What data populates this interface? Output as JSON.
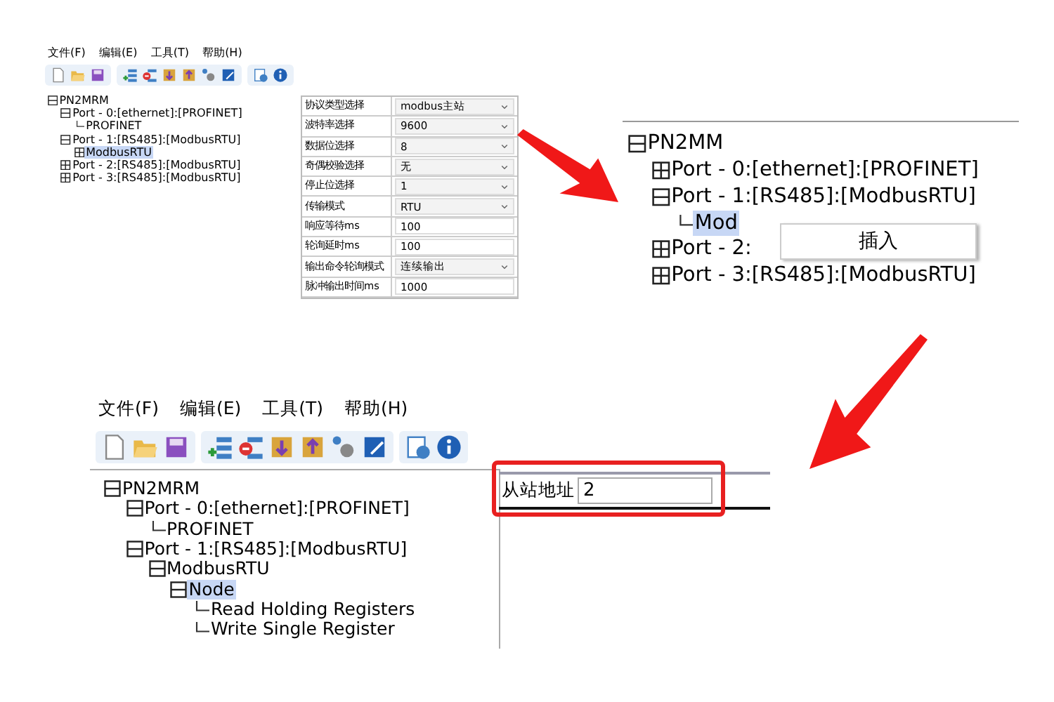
{
  "top_left_screenshot": {
    "menu": [
      "文件(F)",
      "编辑(E)",
      "工具(T)",
      "帮助(H)"
    ],
    "tree": [
      {
        "label": "PN2MRM",
        "expanded": true,
        "selected": false,
        "children": [
          {
            "label": "Port - 0:[ethernet]:[PROFINET]",
            "expanded": true,
            "selected": false,
            "children": [
              {
                "label": "PROFINET",
                "selected": false
              }
            ]
          },
          {
            "label": "Port - 1:[RS485]:[ModbusRTU]",
            "expanded": true,
            "selected": false,
            "children": [
              {
                "label": "ModbusRTU",
                "expanded": false,
                "selected": true
              }
            ]
          },
          {
            "label": "Port - 2:[RS485]:[ModbusRTU]",
            "expanded": false,
            "selected": false
          },
          {
            "label": "Port - 3:[RS485]:[ModbusRTU]",
            "expanded": false,
            "selected": false
          }
        ]
      }
    ],
    "properties": [
      {
        "label": "协议类型选择",
        "value": "modbus主站",
        "kind": "select"
      },
      {
        "label": "波特率选择",
        "value": "9600",
        "kind": "select"
      },
      {
        "label": "数据位选择",
        "value": "8",
        "kind": "select"
      },
      {
        "label": "奇偶校验选择",
        "value": "无",
        "kind": "select"
      },
      {
        "label": "停止位选择",
        "value": "1",
        "kind": "select"
      },
      {
        "label": "传输模式",
        "value": "RTU",
        "kind": "select"
      },
      {
        "label": "响应等待ms",
        "value": "100",
        "kind": "input"
      },
      {
        "label": "轮询延时ms",
        "value": "100",
        "kind": "input"
      },
      {
        "label": "输出命令轮询模式",
        "value": "连续输出",
        "kind": "select"
      },
      {
        "label": "脉冲输出时间ms",
        "value": "1000",
        "kind": "input"
      }
    ]
  },
  "top_right_screenshot": {
    "tree": [
      {
        "label": "PN2MM",
        "expanded": true,
        "selected": false,
        "children": [
          {
            "label": "Port - 0:[ethernet]:[PROFINET]",
            "expanded": false,
            "selected": false
          },
          {
            "label": "Port - 1:[RS485]:[ModbusRTU]",
            "expanded": true,
            "selected": false,
            "children": [
              {
                "label": "Mod",
                "selected": true
              }
            ]
          },
          {
            "label": "Port - 2:",
            "expanded": false,
            "selected": false
          },
          {
            "label": "Port - 3:[RS485]:[ModbusRTU]",
            "expanded": false,
            "selected": false
          }
        ]
      }
    ],
    "context_menu": [
      "插入"
    ]
  },
  "bottom_screenshot": {
    "menu": [
      "文件(F)",
      "编辑(E)",
      "工具(T)",
      "帮助(H)"
    ],
    "tree": [
      {
        "label": "PN2MRM",
        "expanded": true,
        "selected": false,
        "children": [
          {
            "label": "Port - 0:[ethernet]:[PROFINET]",
            "expanded": true,
            "selected": false,
            "children": [
              {
                "label": "PROFINET",
                "selected": false
              }
            ]
          },
          {
            "label": "Port - 1:[RS485]:[ModbusRTU]",
            "expanded": true,
            "selected": false,
            "children": [
              {
                "label": "ModbusRTU",
                "expanded": true,
                "selected": false,
                "children": [
                  {
                    "label": "Node",
                    "expanded": true,
                    "selected": true,
                    "children": [
                      {
                        "label": "Read Holding Registers",
                        "selected": false
                      },
                      {
                        "label": "Write Single Register",
                        "selected": false
                      }
                    ]
                  }
                ]
              }
            ]
          }
        ]
      }
    ],
    "field": {
      "label": "从站地址",
      "value": "2"
    }
  }
}
